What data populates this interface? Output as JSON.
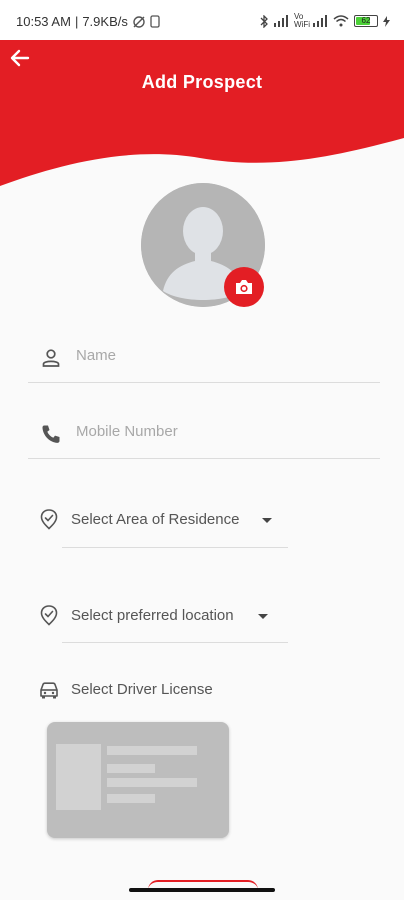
{
  "status_bar": {
    "time": "10:53 AM",
    "separator": "|",
    "speed": "7.9KB/s",
    "battery_level": "62",
    "network_label": "Vo WiFi"
  },
  "header": {
    "title": "Add Prospect",
    "brand_color": "#e31e24"
  },
  "avatar": {
    "icon": "person-placeholder-icon",
    "camera_icon": "camera-icon"
  },
  "form": {
    "name_placeholder": "Name",
    "mobile_placeholder": "Mobile Number",
    "area_label": "Select Area of Residence",
    "location_label": "Select preferred location",
    "license_label": "Select Driver License"
  }
}
